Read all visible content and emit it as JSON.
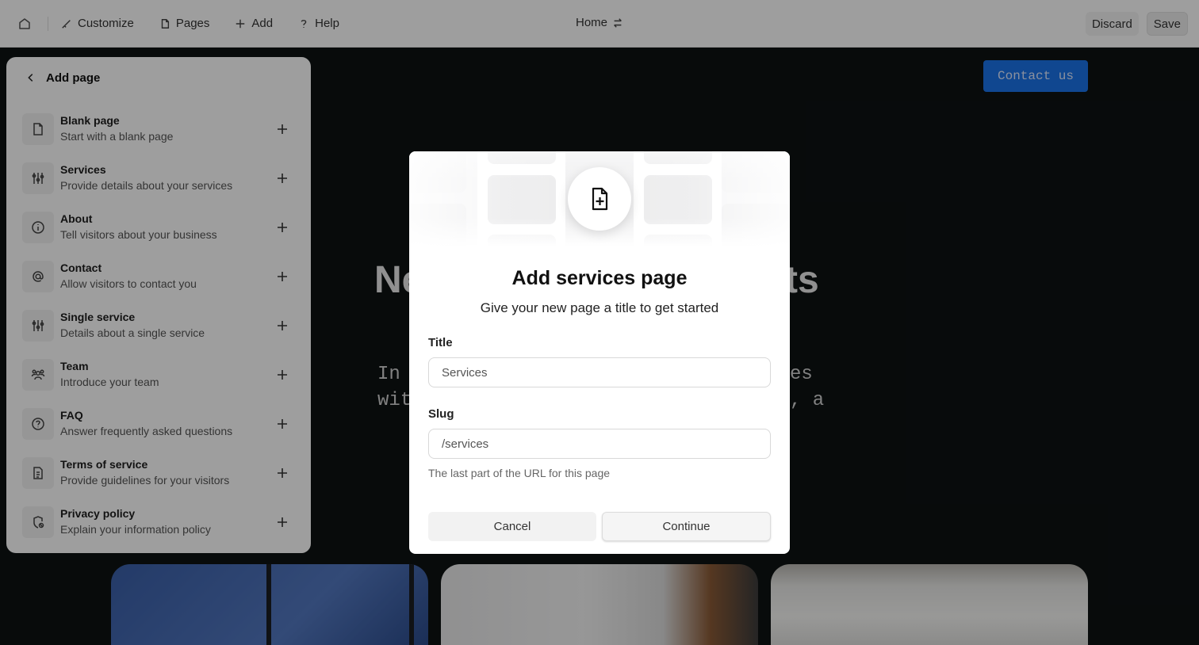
{
  "topbar": {
    "nav": [
      {
        "label": "Customize",
        "icon": "brush-icon"
      },
      {
        "label": "Pages",
        "icon": "page-icon"
      },
      {
        "label": "Add",
        "icon": "plus-icon"
      },
      {
        "label": "Help",
        "icon": "question-icon"
      }
    ],
    "current_page": "Home",
    "discard_label": "Discard",
    "save_label": "Save"
  },
  "background": {
    "contact_label": "Contact us",
    "hero_title_left": "Ne",
    "hero_title_right": "ts",
    "hero_sub_left": [
      "In",
      "wit"
    ],
    "hero_sub_right": [
      "es",
      ", a"
    ]
  },
  "panel": {
    "title": "Add page",
    "items": [
      {
        "name": "Blank page",
        "desc": "Start with a blank page",
        "icon": "page-icon"
      },
      {
        "name": "Services",
        "desc": "Provide details about your services",
        "icon": "sliders-icon"
      },
      {
        "name": "About",
        "desc": "Tell visitors about your business",
        "icon": "info-icon"
      },
      {
        "name": "Contact",
        "desc": "Allow visitors to contact you",
        "icon": "at-icon"
      },
      {
        "name": "Single service",
        "desc": "Details about a single service",
        "icon": "sliders-icon"
      },
      {
        "name": "Team",
        "desc": "Introduce your team",
        "icon": "team-icon"
      },
      {
        "name": "FAQ",
        "desc": "Answer frequently asked questions",
        "icon": "question-circle-icon"
      },
      {
        "name": "Terms of service",
        "desc": "Provide guidelines for your visitors",
        "icon": "document-icon"
      },
      {
        "name": "Privacy policy",
        "desc": "Explain your information policy",
        "icon": "privacy-icon"
      }
    ]
  },
  "modal": {
    "title": "Add services page",
    "subtitle": "Give your new page a title to get started",
    "title_label": "Title",
    "title_value": "Services",
    "slug_label": "Slug",
    "slug_value": "/services",
    "slug_help": "The last part of the URL for this page",
    "cancel_label": "Cancel",
    "continue_label": "Continue"
  }
}
